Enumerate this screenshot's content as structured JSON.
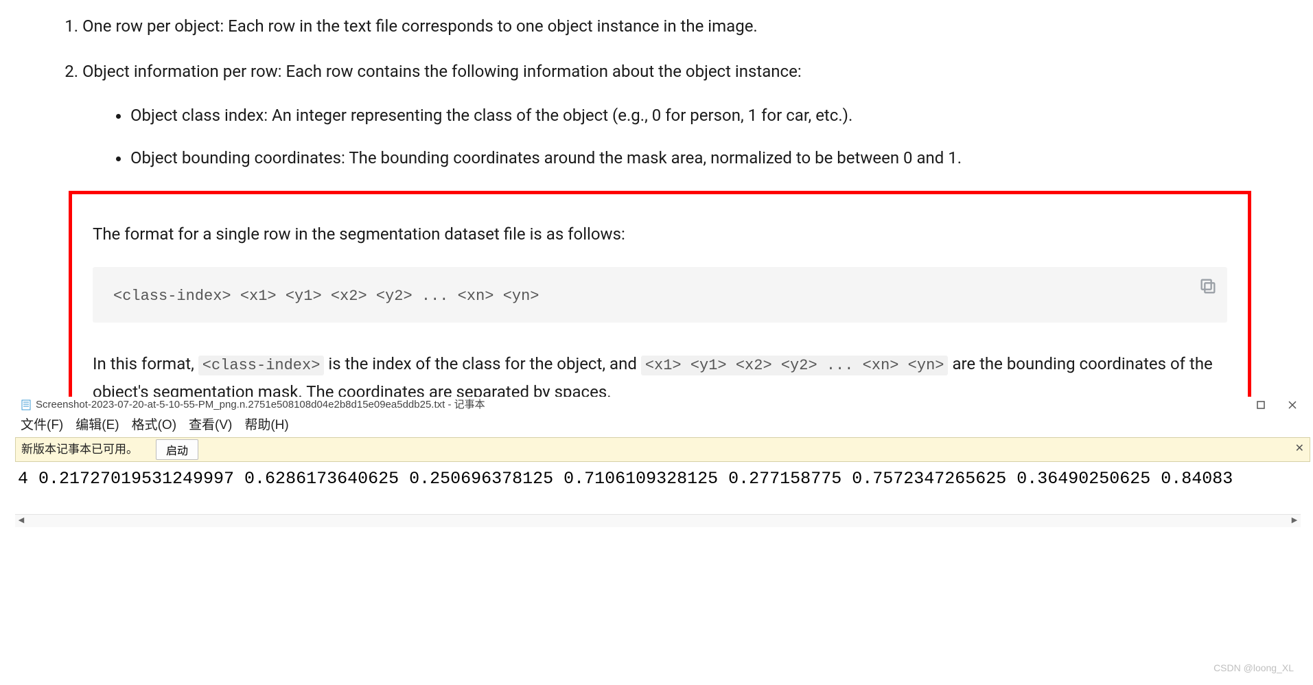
{
  "doc": {
    "item2": "One row per object: Each row in the text file corresponds to one object instance in the image.",
    "item3": "Object information per row: Each row contains the following information about the object instance:",
    "bullet1": "Object class index: An integer representing the class of the object (e.g., 0 for person, 1 for car, etc.).",
    "bullet2": "Object bounding coordinates: The bounding coordinates around the mask area, normalized to be between 0 and 1.",
    "redbox_intro": "The format for a single row in the segmentation dataset file is as follows:",
    "code_line": "<class-index> <x1> <y1> <x2> <y2> ... <xn> <yn>",
    "p2_pre": "In this format, ",
    "p2_code1": "<class-index>",
    "p2_mid": " is the index of the class for the object, and ",
    "p2_code2": "<x1> <y1> <x2> <y2> ... <xn> <yn>",
    "p2_post": " are the bounding coordinates of the object's segmentation mask. The coordinates are separated by spaces."
  },
  "notepad": {
    "title_text": "Screenshot-2023-07-20-at-5-10-55-PM_png.n.2751e508108d04e2b8d15e09ea5ddb25.txt - 记事本",
    "menu": {
      "file": "文件(F)",
      "edit": "编辑(E)",
      "format": "格式(O)",
      "view": "查看(V)",
      "help": "帮助(H)"
    },
    "notice": "新版本记事本已可用。",
    "launch": "启动",
    "content": "4 0.21727019531249997 0.6286173640625 0.250696378125 0.7106109328125 0.277158775 0.7572347265625 0.36490250625 0.84083"
  },
  "watermark": "CSDN @loong_XL"
}
